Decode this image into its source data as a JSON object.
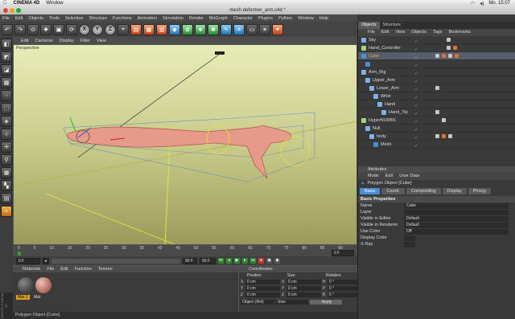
{
  "mac_menubar": {
    "apple": "",
    "app_name": "CINEMA 4D",
    "window_menu": "Window",
    "day_time": "Mo. 15:07"
  },
  "window": {
    "title": "mesh deformer_arm.c4d *"
  },
  "app_menu": [
    "File",
    "Edit",
    "Objects",
    "Tools",
    "Selection",
    "Structure",
    "Functions",
    "Animation",
    "Simulation",
    "Render",
    "MoGraph",
    "Character",
    "Plugins",
    "Python",
    "Window",
    "Help"
  ],
  "toolbar": {
    "axis_x": "X",
    "axis_y": "Y",
    "axis_z": "Z"
  },
  "viewport": {
    "menu": [
      "Edit",
      "Cameras",
      "Display",
      "Filter",
      "View"
    ],
    "label": "Perspective"
  },
  "timeline": {
    "ticks": [
      "0",
      "5",
      "10",
      "15",
      "20",
      "25",
      "30",
      "35",
      "40",
      "45",
      "50",
      "55",
      "60",
      "65",
      "70",
      "75",
      "80",
      "85",
      "90"
    ],
    "current_frame": "0 F",
    "start_field": "0 F",
    "end_field": "90 F",
    "min_field": "90 F",
    "frame_readout": "0 F"
  },
  "materials": {
    "menu": [
      "File",
      "Edit",
      "Function",
      "Texture"
    ],
    "title": "Materials",
    "items": [
      "Mat.1",
      "Mat"
    ]
  },
  "coordinates": {
    "title": "Coordinates",
    "headers": [
      "Position",
      "Size",
      "Rotation"
    ],
    "rows": [
      {
        "axis": "X",
        "pos": "0 cm",
        "size": "0 cm",
        "rot_axis": "H",
        "rot": "0 °"
      },
      {
        "axis": "Y",
        "pos": "0 cm",
        "size": "0 cm",
        "rot_axis": "P",
        "rot": "0 °"
      },
      {
        "axis": "Z",
        "pos": "0 cm",
        "size": "0 cm",
        "rot_axis": "B",
        "rot": "0 °"
      }
    ],
    "mode": "Object (Rel)",
    "size_mode": "Size",
    "apply": "Apply"
  },
  "status": {
    "text": "Polygon Object [Cube]"
  },
  "object_manager": {
    "tabs": [
      "Objects",
      "Structure"
    ],
    "menu": [
      "File",
      "Edit",
      "View",
      "Objects",
      "Tags",
      "Bookmarks"
    ],
    "tree": [
      {
        "name": "Sky",
        "indent": 0,
        "selected": false
      },
      {
        "name": "Hand_Controller",
        "indent": 0,
        "selected": false
      },
      {
        "name": "Cube",
        "indent": 0,
        "selected": true
      },
      {
        "name": "",
        "indent": 1,
        "selected": false
      },
      {
        "name": "Arm_Rig",
        "indent": 0,
        "selected": false
      },
      {
        "name": "Upper_Arm",
        "indent": 1,
        "selected": false
      },
      {
        "name": "Lower_Arm",
        "indent": 2,
        "selected": false
      },
      {
        "name": "Wrist",
        "indent": 3,
        "selected": false
      },
      {
        "name": "Hand",
        "indent": 4,
        "selected": false
      },
      {
        "name": "Hand_Tip",
        "indent": 5,
        "selected": false
      },
      {
        "name": "HyperNURBS",
        "indent": 0,
        "selected": false
      },
      {
        "name": "Null",
        "indent": 1,
        "selected": false
      },
      {
        "name": "body",
        "indent": 2,
        "selected": false
      },
      {
        "name": "Mesh",
        "indent": 3,
        "selected": false
      }
    ]
  },
  "attributes": {
    "title": "Attributes",
    "menu": [
      "Mode",
      "Edit",
      "User Data"
    ],
    "object_label": "Polygon Object [Cube]",
    "tabs": [
      "Basic",
      "Coord.",
      "Compositing",
      "Display",
      "Phong"
    ],
    "section": "Basic Properties",
    "props": [
      {
        "label": "Name",
        "value": "Cube"
      },
      {
        "label": "Layer",
        "value": ""
      },
      {
        "label": "Visible in Editor",
        "value": "Default"
      },
      {
        "label": "Visible in Renderer",
        "value": "Default"
      },
      {
        "label": "Use Color",
        "value": "Off"
      },
      {
        "label": "Display Color",
        "value": ""
      },
      {
        "label": "X-Ray",
        "value": ""
      }
    ]
  },
  "brand": {
    "maxon": "MAXON CINEMA 4D"
  },
  "colors": {
    "accent": "#4a8fd6",
    "selected_text": "#f0a030",
    "viewport_top": "#e8edb8",
    "viewport_bottom": "#9b9a5c"
  }
}
